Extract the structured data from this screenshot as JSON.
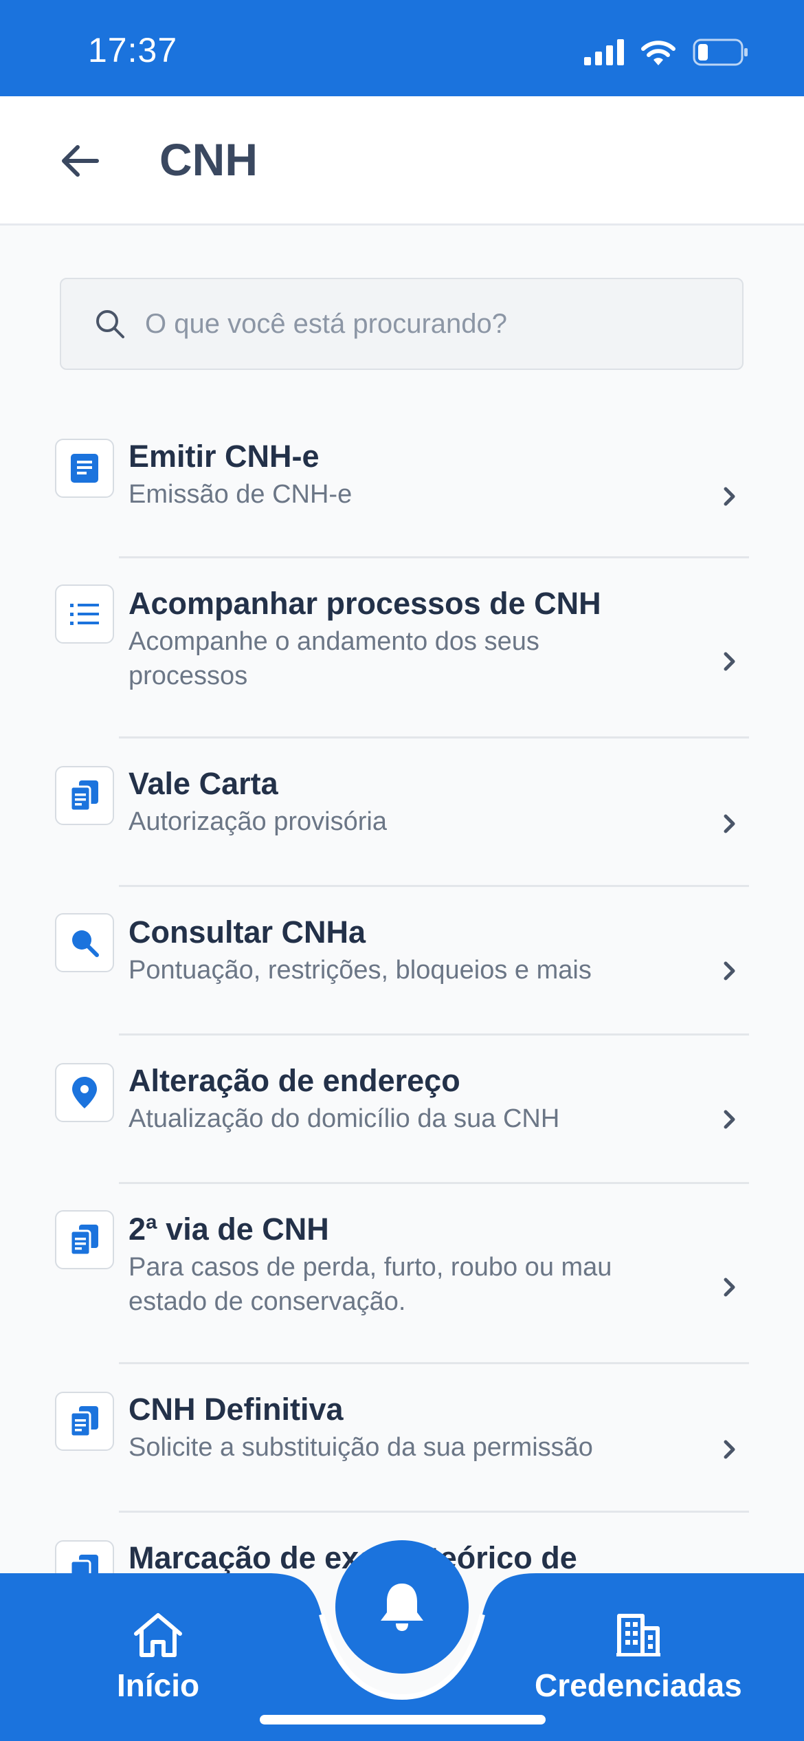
{
  "status_bar": {
    "time": "17:37"
  },
  "header": {
    "title": "CNH"
  },
  "search": {
    "placeholder": "O que você está procurando?"
  },
  "items": [
    {
      "title": "Emitir CNH-e",
      "subtitle": "Emissão de CNH-e",
      "icon": "document-icon"
    },
    {
      "title": "Acompanhar processos de CNH",
      "subtitle": "Acompanhe o andamento dos seus processos",
      "icon": "list-icon"
    },
    {
      "title": "Vale Carta",
      "subtitle": "Autorização provisória",
      "icon": "copy-document-icon"
    },
    {
      "title": "Consultar CNHa",
      "subtitle": "Pontuação, restrições, bloqueios e mais",
      "icon": "search-icon"
    },
    {
      "title": "Alteração de endereço",
      "subtitle": "Atualização do domicílio da sua CNH",
      "icon": "location-pin-icon"
    },
    {
      "title": "2ª via de CNH",
      "subtitle": "Para casos de perda, furto, roubo ou mau estado de conservação.",
      "icon": "copy-document-icon"
    },
    {
      "title": "CNH Definitiva",
      "subtitle": "Solicite a substituição da sua permissão",
      "icon": "copy-document-icon"
    },
    {
      "title": "Marcação de exame teórico de",
      "subtitle": "",
      "icon": "copy-document-icon"
    }
  ],
  "bottom_nav": {
    "home_label": "Início",
    "accredited_label": "Credenciadas",
    "center_icon": "bell-icon"
  },
  "colors": {
    "primary": "#1b73dd",
    "title": "#233149",
    "subtitle": "#6b7686"
  }
}
